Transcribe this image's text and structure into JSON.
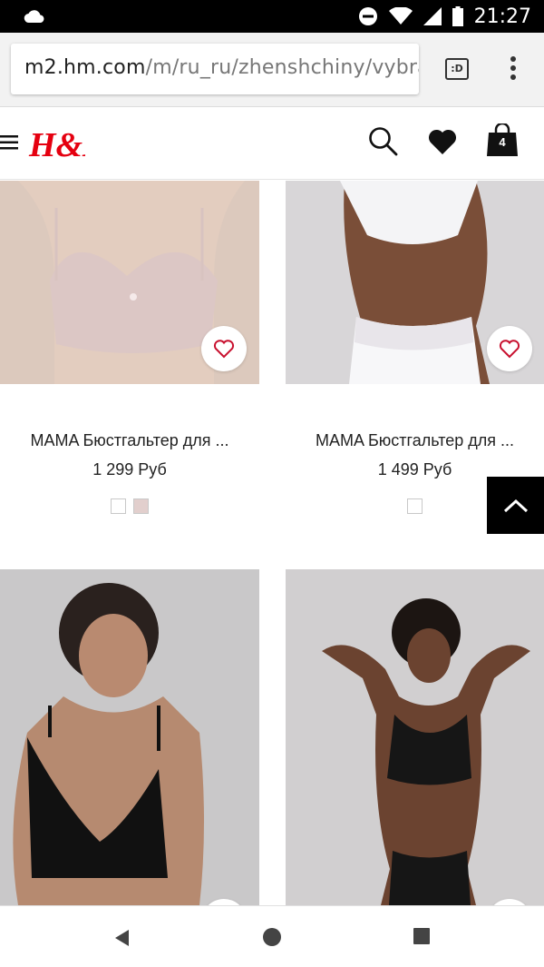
{
  "status_bar": {
    "time": "21:27",
    "icons": [
      "cloud-icon",
      "do-not-disturb-icon",
      "wifi-icon",
      "signal-icon",
      "battery-icon"
    ]
  },
  "browser": {
    "url_host": "m2.hm.com",
    "url_path": "/m/ru_ru/zhenshchiny/vybrat",
    "amp_label": ":D",
    "icons": [
      "amp-icon",
      "more-vert-icon"
    ]
  },
  "header": {
    "logo_text": "H&M",
    "bag_count": "4",
    "icons": [
      "menu-icon",
      "search-icon",
      "heart-icon",
      "bag-icon"
    ],
    "colors": {
      "brand": "#e50010"
    }
  },
  "products": [
    {
      "name": "MAMA Бюстгальтер для ...",
      "price": "1 299 Руб",
      "swatches": [
        "#ffffff",
        "#e2cfcd"
      ],
      "image_desc": "pink lace nursing bra"
    },
    {
      "name": "MAMA Бюстгальтер для ...",
      "price": "1 499 Руб",
      "swatches": [
        "#ffffff"
      ],
      "image_desc": "white nursing bra"
    },
    {
      "name": "",
      "price": "",
      "swatches": [],
      "image_desc": "black nursing bra"
    },
    {
      "name": "",
      "price": "",
      "swatches": [],
      "image_desc": "black nursing bra set"
    }
  ],
  "nav": {
    "icons": [
      "back-icon",
      "home-icon",
      "recents-icon"
    ]
  }
}
